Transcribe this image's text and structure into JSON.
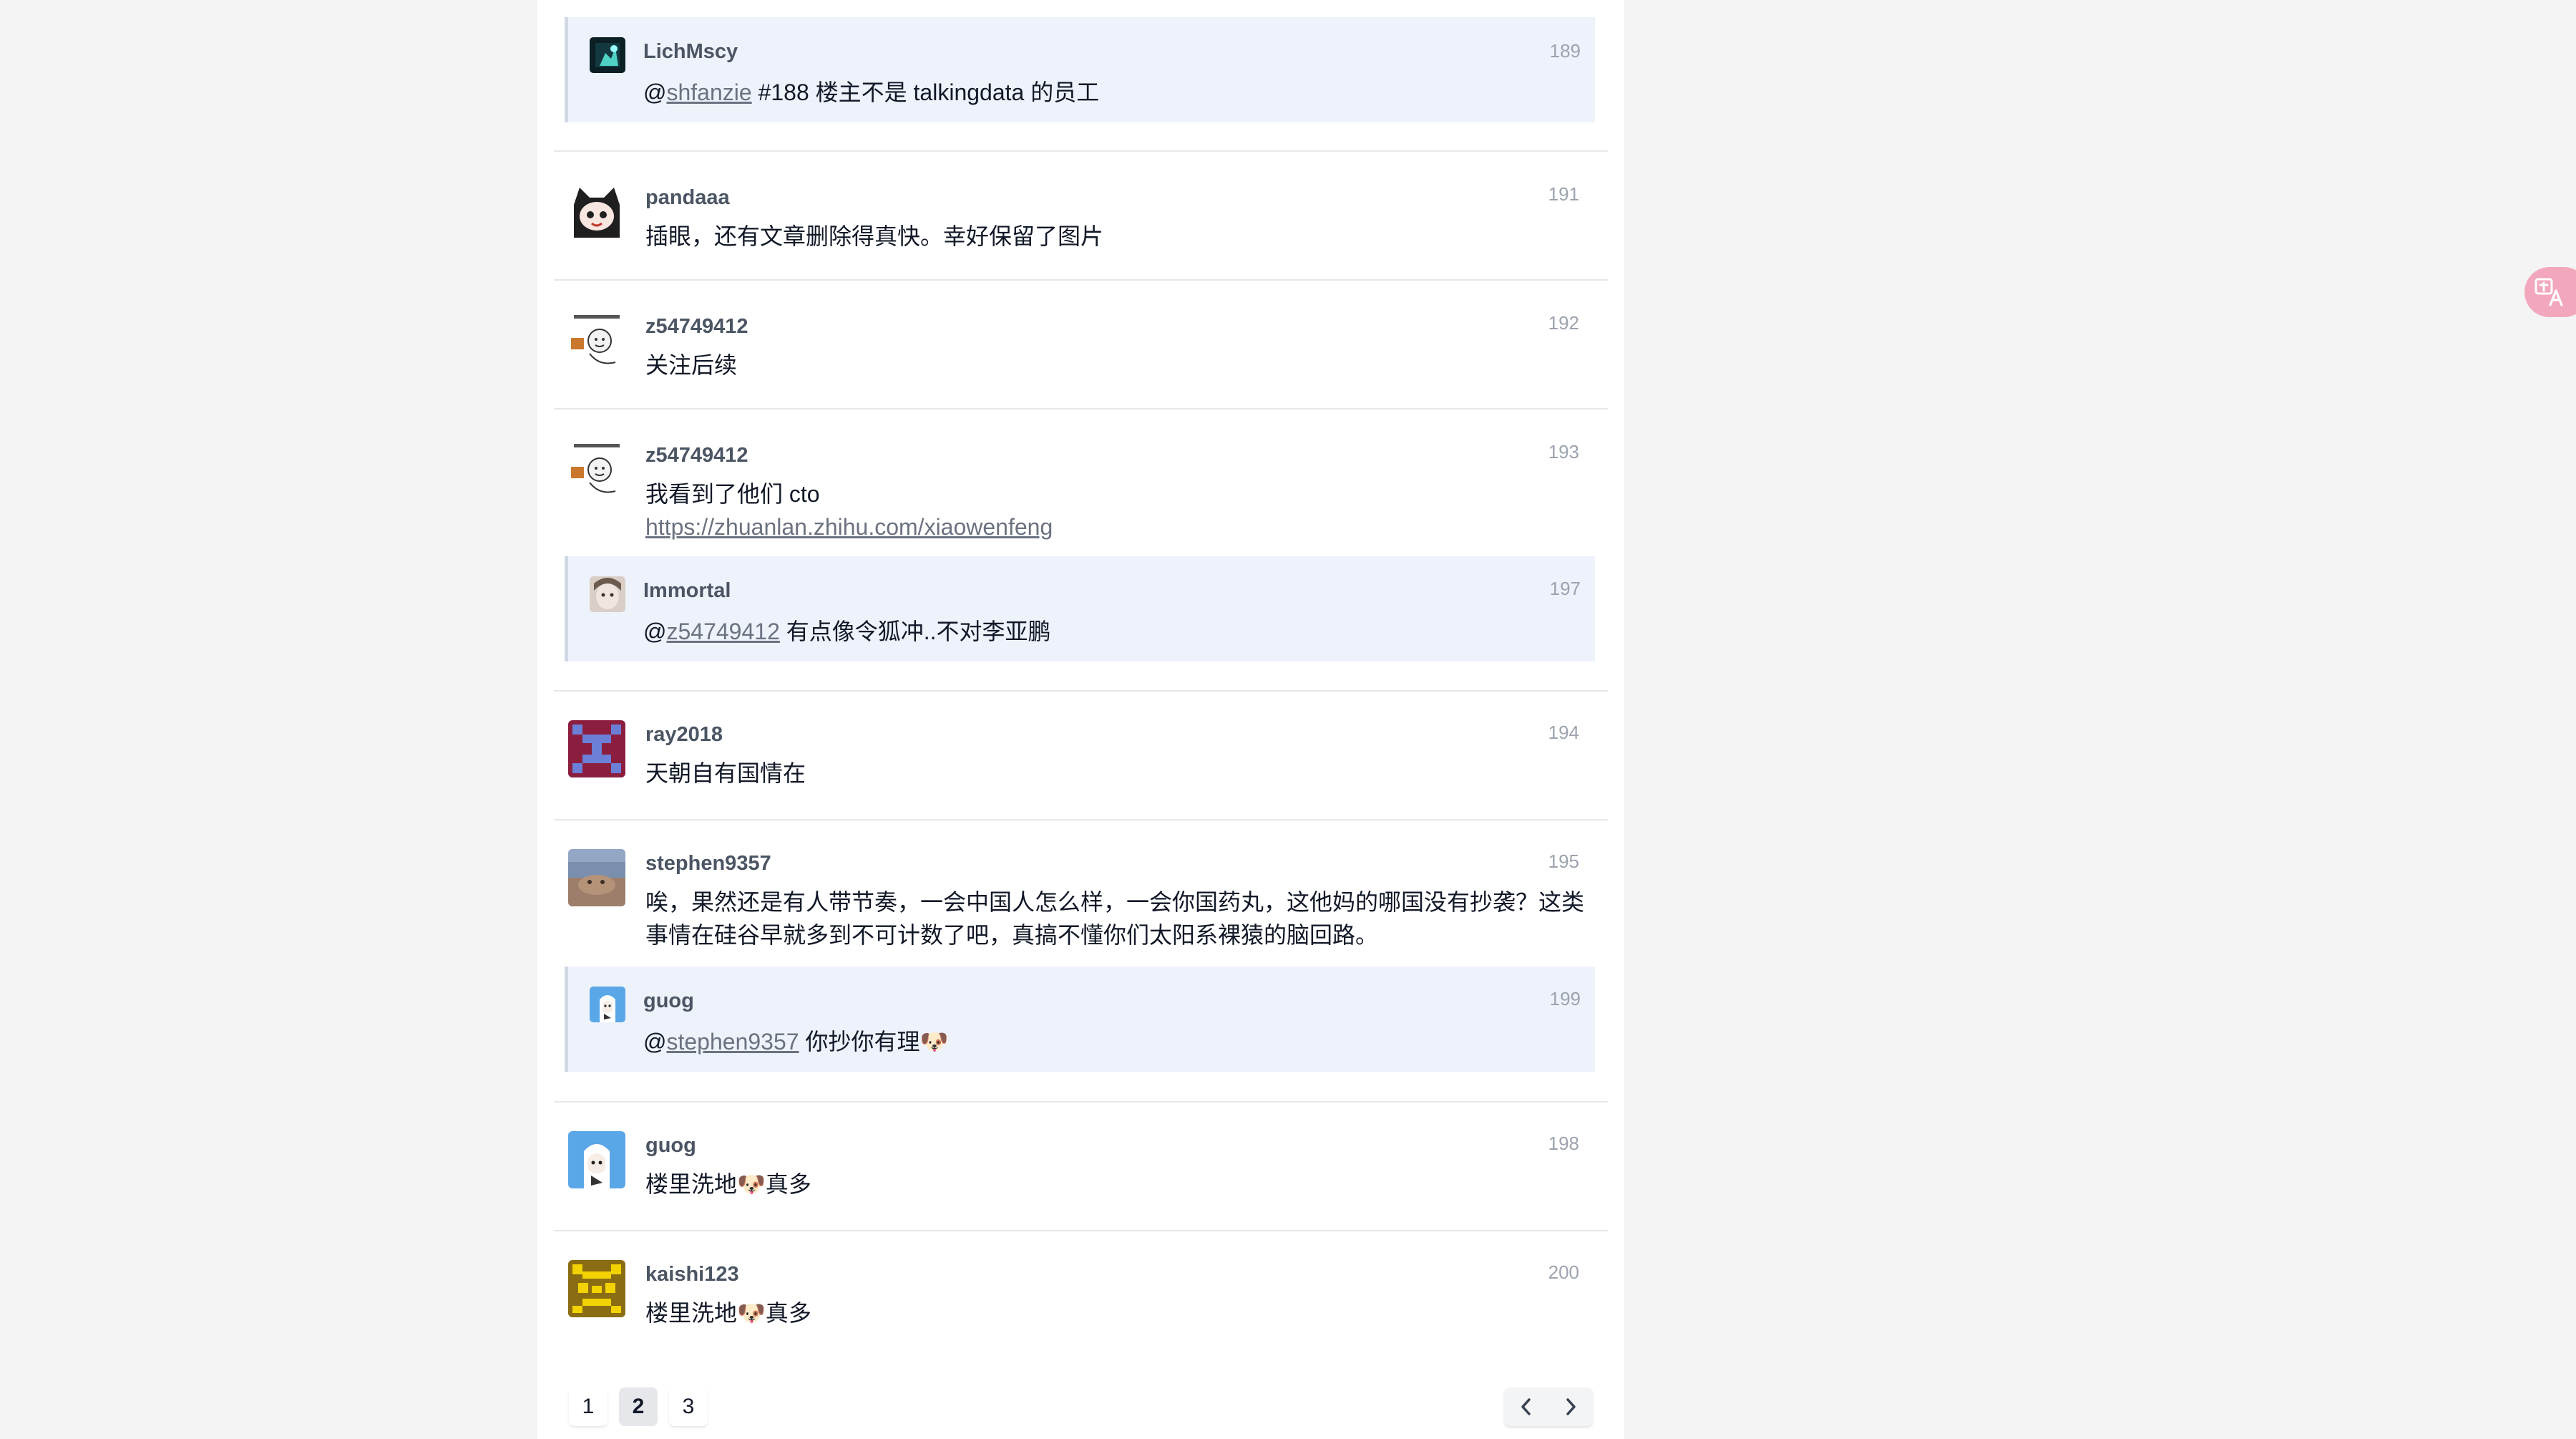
{
  "posts": [
    {
      "floor": "191",
      "username": "pandaaa",
      "avatar_icon": "cat-hood-avatar",
      "content": "插眼，还有文章删除得真快。幸好保留了图片"
    },
    {
      "floor": "192",
      "username": "z54749412",
      "avatar_icon": "meme-sticker-avatar",
      "content": "关注后续"
    },
    {
      "floor": "193",
      "username": "z54749412",
      "avatar_icon": "meme-sticker-avatar",
      "content_line1": "我看到了他们 cto",
      "content_link": "https://zhuanlan.zhihu.com/xiaowenfeng"
    },
    {
      "floor": "194",
      "username": "ray2018",
      "avatar_icon": "pixel-identicon-avatar",
      "content": "天朝自有国情在"
    },
    {
      "floor": "195",
      "username": "stephen9357",
      "avatar_icon": "photo-avatar",
      "content": "唉，果然还是有人带节奏，一会中国人怎么样，一会你国药丸，这他妈的哪国没有抄袭？这类事情在硅谷早就多到不可计数了吧，真搞不懂你们太阳系裸猿的脑回路。"
    },
    {
      "floor": "198",
      "username": "guog",
      "avatar_icon": "anime-avatar",
      "content": "楼里洗地🐶真多"
    },
    {
      "floor": "200",
      "username": "kaishi123",
      "avatar_icon": "pixel-identicon-avatar",
      "content": "楼里洗地🐶真多"
    }
  ],
  "replies": [
    {
      "floor": "189",
      "username": "LichMscy",
      "avatar_icon": "dark-avatar",
      "mention_prefix": "@",
      "mention": "shfanzie",
      "text": " #188 楼主不是 talkingdata 的员工"
    },
    {
      "floor": "197",
      "username": "Immortal",
      "avatar_icon": "photo-avatar",
      "mention_prefix": "@",
      "mention": "z54749412",
      "text": " 有点像令狐冲..不对李亚鹏"
    },
    {
      "floor": "199",
      "username": "guog",
      "avatar_icon": "anime-avatar",
      "mention_prefix": "@",
      "mention": "stephen9357",
      "text": " 你抄你有理🐶"
    }
  ],
  "pagination": {
    "pages": [
      "1",
      "2",
      "3"
    ],
    "current": "2"
  },
  "translate_widget": {
    "icon": "translate-icon"
  },
  "colors": {
    "page_background": "#f4f4f5",
    "reply_background": "#eef2fb",
    "username": "#4b5563",
    "floor_number": "#9ca3af",
    "translate_widget": "#f2a7bd"
  }
}
